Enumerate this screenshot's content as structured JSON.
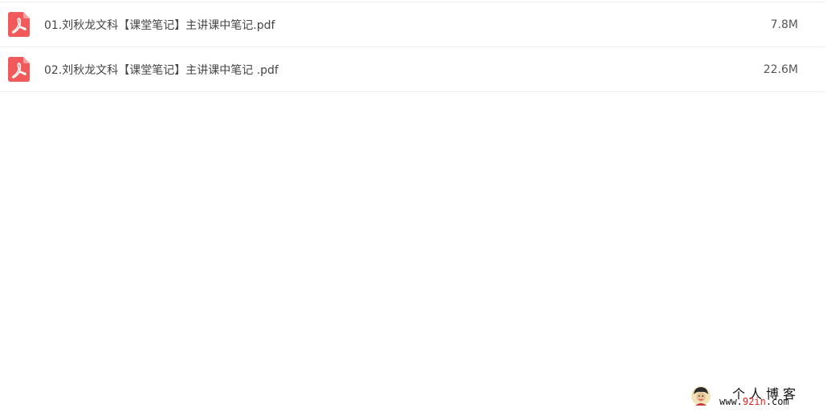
{
  "files": [
    {
      "name": "01.刘秋龙文科【课堂笔记】主讲课中笔记.pdf",
      "size": "7.8M",
      "icon": "pdf-icon"
    },
    {
      "name": "02.刘秋龙文科【课堂笔记】主讲课中笔记 .pdf",
      "size": "22.6M",
      "icon": "pdf-icon"
    }
  ],
  "watermark": {
    "title": "个人博客",
    "url_prefix": "www.",
    "url_accent": "92in",
    "url_suffix": ".com"
  },
  "colors": {
    "pdf_icon": "#f05a5a",
    "url_accent": "#e02020"
  }
}
